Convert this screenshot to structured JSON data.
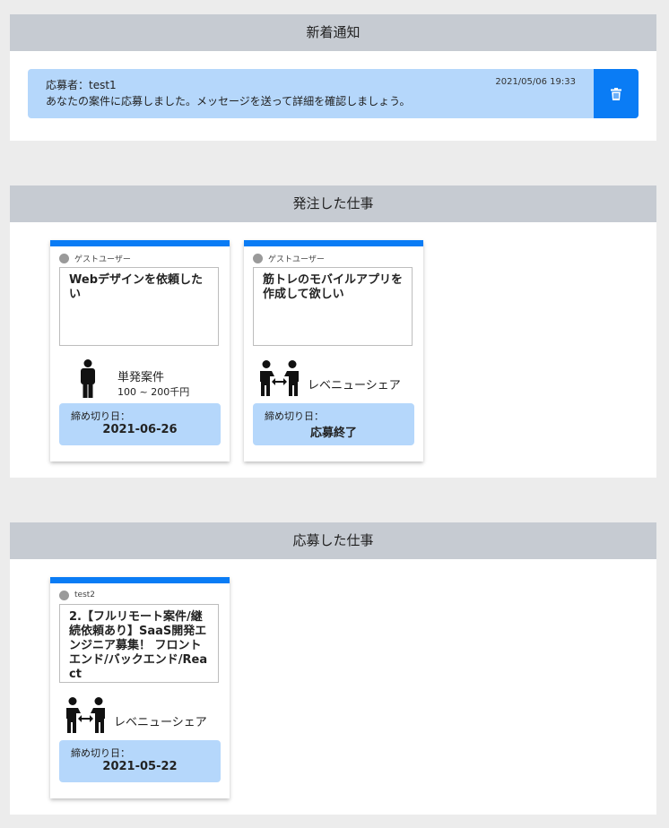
{
  "notifications": {
    "header": "新着通知",
    "items": [
      {
        "applicant": "応募者：test1",
        "time": "2021/05/06 19:33",
        "message": "あなたの案件に応募しました。メッセージを送って詳細を確認しましょう。",
        "delete_icon": "trash-icon"
      }
    ]
  },
  "ordered": {
    "header": "発注した仕事",
    "cards": [
      {
        "user": "ゲストユーザー",
        "title": "Webデザインを依頼したい",
        "type": "単発案件",
        "type_icon": "person-icon",
        "budget": "100 ~ 200千円",
        "deadline_label": "締め切り日：",
        "deadline": "2021-06-26"
      },
      {
        "user": "ゲストユーザー",
        "title": "筋トレのモバイルアプリを作成して欲しい",
        "type": "レベニューシェア",
        "type_icon": "revenue-share-icon",
        "deadline_label": "締め切り日：",
        "deadline": "応募終了"
      }
    ]
  },
  "applied": {
    "header": "応募した仕事",
    "cards": [
      {
        "user": "test2",
        "title": "2.【フルリモート案件/継続依頼あり】SaaS開発エンジニア募集！ フロントエンド/バックエンド/React",
        "type": "レベニューシェア",
        "type_icon": "revenue-share-icon",
        "deadline_label": "締め切り日：",
        "deadline": "2021-05-22"
      }
    ]
  },
  "colors": {
    "accent": "#0a7cf5",
    "light_blue": "#b5d7fb",
    "header_gray": "#c6cbd2",
    "background": "#ececec"
  }
}
